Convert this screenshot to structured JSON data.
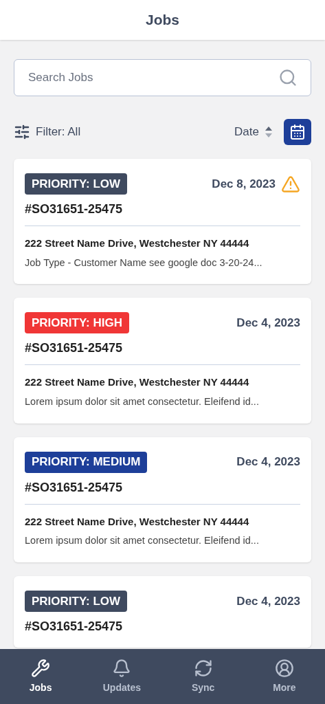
{
  "header": {
    "title": "Jobs"
  },
  "search": {
    "placeholder": "Search Jobs"
  },
  "filter": {
    "label": "Filter: All"
  },
  "sort": {
    "label": "Date"
  },
  "jobs": [
    {
      "priority": "PRIORITY: LOW",
      "color": "#3f4a5f",
      "date": "Dec 8, 2023",
      "warning": true,
      "number": "#SO31651-25475",
      "address": "222 Street Name Drive, Westchester NY 44444",
      "description": "Job Type - Customer Name see google doc 3-20-24..."
    },
    {
      "priority": "PRIORITY: HIGH",
      "color": "#f03636",
      "date": "Dec 4, 2023",
      "warning": false,
      "number": "#SO31651-25475",
      "address": "222 Street Name Drive, Westchester NY 44444",
      "description": "Lorem ipsum dolor sit amet consectetur. Eleifend id..."
    },
    {
      "priority": "PRIORITY: MEDIUM",
      "color": "#1e3f99",
      "date": "Dec 4, 2023",
      "warning": false,
      "number": "#SO31651-25475",
      "address": "222 Street Name Drive, Westchester NY 44444",
      "description": "Lorem ipsum dolor sit amet consectetur. Eleifend id..."
    },
    {
      "priority": "PRIORITY: LOW",
      "color": "#3f4a5f",
      "date": "Dec 4, 2023",
      "warning": false,
      "number": "#SO31651-25475"
    }
  ],
  "nav": [
    {
      "kind": "wrench",
      "label": "Jobs",
      "selected": true
    },
    {
      "kind": "bell",
      "label": "Updates",
      "selected": false
    },
    {
      "kind": "sync",
      "label": "Sync",
      "selected": false
    },
    {
      "kind": "user",
      "label": "More",
      "selected": false
    }
  ]
}
